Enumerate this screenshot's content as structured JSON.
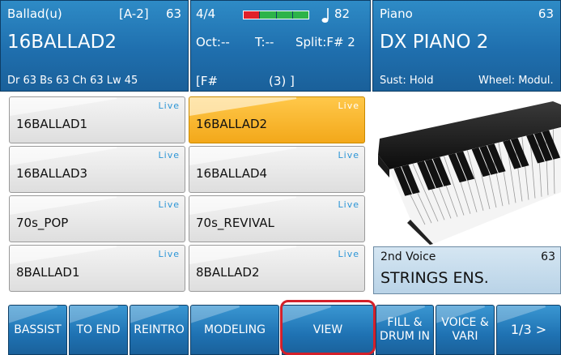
{
  "header": {
    "style_panel": {
      "style_name": "Ballad(u)",
      "variation": "[A-2]",
      "volume": "63",
      "title": "16BALLAD2",
      "tracks": "Dr 63  Bs 63  Ch 63  Lw 45"
    },
    "status_panel": {
      "time_signature": "4/4",
      "tempo": "82",
      "octave": "Oct:--",
      "transpose": "T:--",
      "split": "Split:F# 2",
      "chord": "[F#",
      "chord_extra": "(3) ]",
      "beat_colors": [
        "#e0202a",
        "#2db34a",
        "#2db34a",
        "#2db34a"
      ]
    },
    "voice_panel": {
      "label": "Piano",
      "volume": "63",
      "name": "DX PIANO 2",
      "sustain": "Sust: Hold",
      "wheel": "Wheel: Modul."
    }
  },
  "style_grid": {
    "live_label": "Live",
    "items": [
      {
        "name": "16BALLAD1",
        "selected": false
      },
      {
        "name": "16BALLAD2",
        "selected": true
      },
      {
        "name": "16BALLAD3",
        "selected": false
      },
      {
        "name": "16BALLAD4",
        "selected": false
      },
      {
        "name": "70s_POP",
        "selected": false
      },
      {
        "name": "70s_REVIVAL",
        "selected": false
      },
      {
        "name": "8BALLAD1",
        "selected": false
      },
      {
        "name": "8BALLAD2",
        "selected": false
      }
    ]
  },
  "second_voice": {
    "label": "2nd Voice",
    "volume": "63",
    "name": "STRINGS ENS."
  },
  "bottom_bar": {
    "buttons": [
      {
        "label": "BASSIST"
      },
      {
        "label": "TO END"
      },
      {
        "label": "REINTRO"
      },
      {
        "label": "MODELING"
      },
      {
        "label": "VIEW"
      },
      {
        "label": "FILL & DRUM IN"
      },
      {
        "label": "VOICE & VARI"
      },
      {
        "label": "1/3 >"
      }
    ]
  },
  "colors": {
    "panel_blue": "#1f6fae",
    "selected_orange": "#f3a81a",
    "live_blue": "#2b95d6",
    "highlight_red": "#d3202a"
  }
}
